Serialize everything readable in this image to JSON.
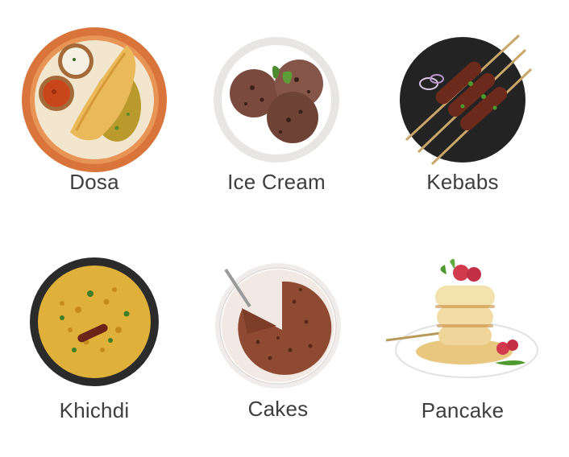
{
  "categories": [
    {
      "label": "Dosa",
      "icon": "dosa-plate-image"
    },
    {
      "label": "Ice Cream",
      "icon": "ice-cream-bowl-image"
    },
    {
      "label": "Kebabs",
      "icon": "kebabs-plate-image"
    },
    {
      "label": "Khichdi",
      "icon": "khichdi-pan-image"
    },
    {
      "label": "Cakes",
      "icon": "cake-plate-image"
    },
    {
      "label": "Pancake",
      "icon": "pancake-stack-image"
    }
  ],
  "colors": {
    "label_text": "#3e3e3e",
    "background": "#ffffff"
  }
}
